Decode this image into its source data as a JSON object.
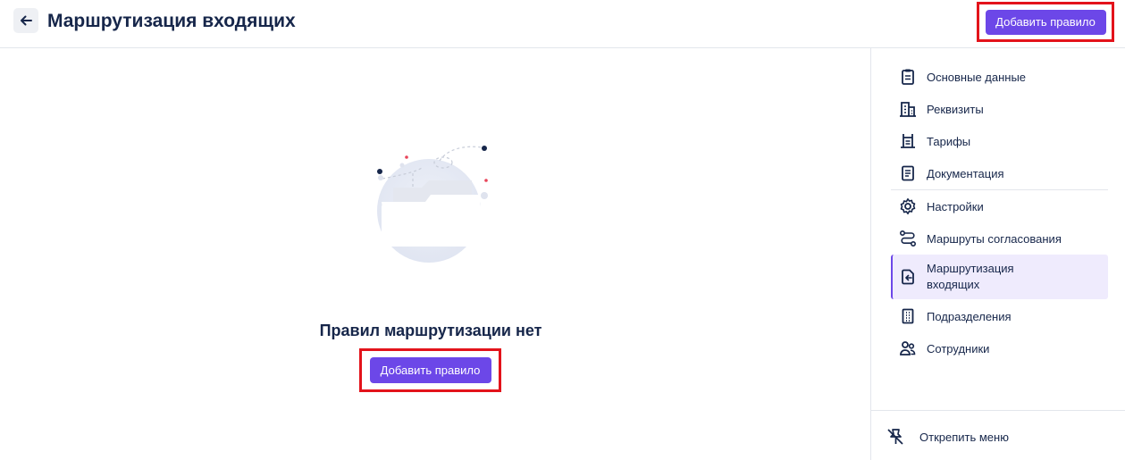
{
  "header": {
    "title": "Маршрутизация входящих",
    "add_button": "Добавить правило"
  },
  "empty_state": {
    "title": "Правил маршрутизации нет",
    "add_button": "Добавить правило"
  },
  "sidebar": {
    "items": [
      {
        "label": "Основные данные",
        "icon": "clipboard-icon"
      },
      {
        "label": "Реквизиты",
        "icon": "building-icon"
      },
      {
        "label": "Тарифы",
        "icon": "tariff-icon"
      },
      {
        "label": "Документация",
        "icon": "document-icon"
      },
      {
        "label": "Настройки",
        "icon": "gear-icon"
      },
      {
        "label": "Маршруты согласования",
        "icon": "route-icon"
      },
      {
        "label_line1": "Маршрутизация",
        "label_line2": "входящих",
        "icon": "incoming-doc-icon",
        "active": true
      },
      {
        "label": "Подразделения",
        "icon": "office-building-icon"
      },
      {
        "label": "Сотрудники",
        "icon": "users-icon"
      }
    ],
    "unpin_label": "Открепить меню"
  },
  "colors": {
    "accent": "#6c47e8",
    "highlight": "#e3131b",
    "active_bg": "#efebfd",
    "text": "#16264a"
  }
}
